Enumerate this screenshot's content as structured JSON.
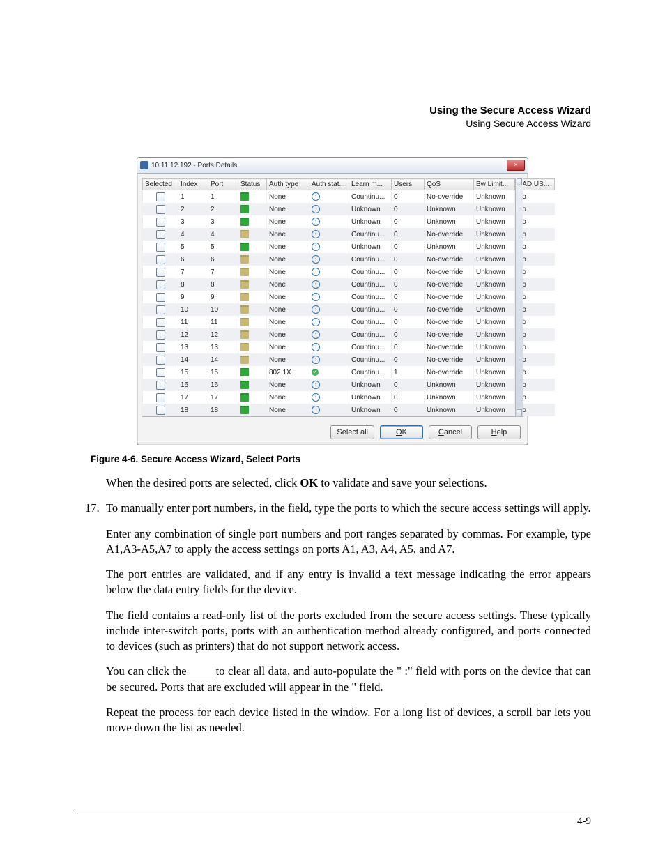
{
  "header": {
    "title": "Using the Secure Access Wizard",
    "subtitle": "Using Secure Access Wizard"
  },
  "window": {
    "title": "10.11.12.192  - Ports Details",
    "close_label": "×"
  },
  "columns": {
    "selected": "Selected",
    "index": "Index",
    "port": "Port",
    "status": "Status",
    "auth_type": "Auth type",
    "auth_stat": "Auth stat...",
    "learn": "Learn m...",
    "users": "Users",
    "qos": "QoS",
    "bw": "Bw Limit...",
    "radius": "RADIUS..."
  },
  "rows": [
    {
      "index": "1",
      "port": "1",
      "status": "green",
      "auth_type": "None",
      "auth_stat": "up",
      "learn": "Countinu...",
      "users": "0",
      "qos": "No-override",
      "bw": "Unknown",
      "radius": "No"
    },
    {
      "index": "2",
      "port": "2",
      "status": "green",
      "auth_type": "None",
      "auth_stat": "up",
      "learn": "Unknown",
      "users": "0",
      "qos": "Unknown",
      "bw": "Unknown",
      "radius": "No"
    },
    {
      "index": "3",
      "port": "3",
      "status": "green",
      "auth_type": "None",
      "auth_stat": "up",
      "learn": "Unknown",
      "users": "0",
      "qos": "Unknown",
      "bw": "Unknown",
      "radius": "No"
    },
    {
      "index": "4",
      "port": "4",
      "status": "yellow",
      "auth_type": "None",
      "auth_stat": "up",
      "learn": "Countinu...",
      "users": "0",
      "qos": "No-override",
      "bw": "Unknown",
      "radius": "No"
    },
    {
      "index": "5",
      "port": "5",
      "status": "green",
      "auth_type": "None",
      "auth_stat": "up",
      "learn": "Unknown",
      "users": "0",
      "qos": "Unknown",
      "bw": "Unknown",
      "radius": "No"
    },
    {
      "index": "6",
      "port": "6",
      "status": "yellow",
      "auth_type": "None",
      "auth_stat": "up",
      "learn": "Countinu...",
      "users": "0",
      "qos": "No-override",
      "bw": "Unknown",
      "radius": "No"
    },
    {
      "index": "7",
      "port": "7",
      "status": "yellow",
      "auth_type": "None",
      "auth_stat": "up",
      "learn": "Countinu...",
      "users": "0",
      "qos": "No-override",
      "bw": "Unknown",
      "radius": "No"
    },
    {
      "index": "8",
      "port": "8",
      "status": "yellow",
      "auth_type": "None",
      "auth_stat": "up",
      "learn": "Countinu...",
      "users": "0",
      "qos": "No-override",
      "bw": "Unknown",
      "radius": "No"
    },
    {
      "index": "9",
      "port": "9",
      "status": "yellow",
      "auth_type": "None",
      "auth_stat": "up",
      "learn": "Countinu...",
      "users": "0",
      "qos": "No-override",
      "bw": "Unknown",
      "radius": "No"
    },
    {
      "index": "10",
      "port": "10",
      "status": "yellow",
      "auth_type": "None",
      "auth_stat": "up",
      "learn": "Countinu...",
      "users": "0",
      "qos": "No-override",
      "bw": "Unknown",
      "radius": "No"
    },
    {
      "index": "11",
      "port": "11",
      "status": "yellow",
      "auth_type": "None",
      "auth_stat": "up",
      "learn": "Countinu...",
      "users": "0",
      "qos": "No-override",
      "bw": "Unknown",
      "radius": "No"
    },
    {
      "index": "12",
      "port": "12",
      "status": "yellow",
      "auth_type": "None",
      "auth_stat": "up",
      "learn": "Countinu...",
      "users": "0",
      "qos": "No-override",
      "bw": "Unknown",
      "radius": "No"
    },
    {
      "index": "13",
      "port": "13",
      "status": "yellow",
      "auth_type": "None",
      "auth_stat": "up",
      "learn": "Countinu...",
      "users": "0",
      "qos": "No-override",
      "bw": "Unknown",
      "radius": "No"
    },
    {
      "index": "14",
      "port": "14",
      "status": "yellow",
      "auth_type": "None",
      "auth_stat": "up",
      "learn": "Countinu...",
      "users": "0",
      "qos": "No-override",
      "bw": "Unknown",
      "radius": "No"
    },
    {
      "index": "15",
      "port": "15",
      "status": "green",
      "auth_type": "802.1X",
      "auth_stat": "ok",
      "learn": "Countinu...",
      "users": "1",
      "qos": "No-override",
      "bw": "Unknown",
      "radius": "No"
    },
    {
      "index": "16",
      "port": "16",
      "status": "green",
      "auth_type": "None",
      "auth_stat": "up",
      "learn": "Unknown",
      "users": "0",
      "qos": "Unknown",
      "bw": "Unknown",
      "radius": "No"
    },
    {
      "index": "17",
      "port": "17",
      "status": "green",
      "auth_type": "None",
      "auth_stat": "up",
      "learn": "Unknown",
      "users": "0",
      "qos": "Unknown",
      "bw": "Unknown",
      "radius": "No"
    },
    {
      "index": "18",
      "port": "18",
      "status": "green",
      "auth_type": "None",
      "auth_stat": "up",
      "learn": "Unknown",
      "users": "0",
      "qos": "Unknown",
      "bw": "Unknown",
      "radius": "No"
    }
  ],
  "buttons": {
    "select_all": "Select all",
    "ok_pre": "O",
    "ok_u": "K",
    "cancel_u": "C",
    "cancel_post": "ancel",
    "help_u": "H",
    "help_post": "elp"
  },
  "caption": "Figure 4-6. Secure Access Wizard, Select Ports",
  "body": {
    "p1a": "When the desired ports are selected, click ",
    "p1b": "OK",
    "p1c": " to validate and save your selections.",
    "li_num": "17.",
    "p2": "To manually enter port numbers, in the                              field, type the ports to which the secure access settings will apply.",
    "p3": "Enter any combination of single port numbers and port ranges separated by commas. For example, type A1,A3-A5,A7 to apply the access settings on ports A1, A3, A4, A5, and A7.",
    "p4": "The port entries are validated, and if any entry is invalid a text message indicating the error appears below the data entry fields for the device.",
    "p5": "The                                          field contains a read-only list of the ports excluded from the secure access settings. These typically include inter-switch ports, ports with an authentication method already configured, and ports connected to devices (such as printers) that do not support network access.",
    "p6": "You can click the ____ to clear all data, and auto-populate the \"             :\" field with ports on the device that can be secured. Ports that are excluded will appear in the \"                                           field.",
    "p7": "Repeat the process for each device listed in the window. For a long list of devices, a scroll bar lets you move down the list as needed."
  },
  "page_number": "4-9"
}
